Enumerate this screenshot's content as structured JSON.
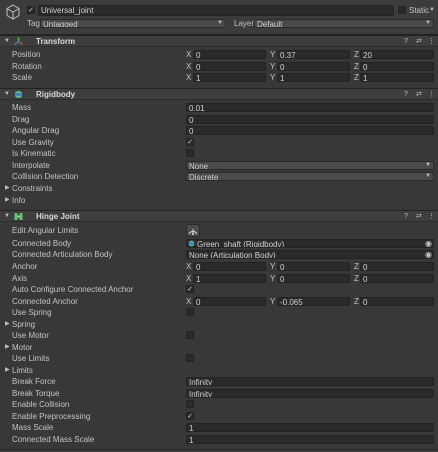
{
  "header": {
    "name": "Universal_joint",
    "static_label": "Static",
    "tag_label": "Tag",
    "tag_value": "Untagged",
    "layer_label": "Layer",
    "layer_value": "Default"
  },
  "transform": {
    "title": "Transform",
    "position_label": "Position",
    "rotation_label": "Rotation",
    "scale_label": "Scale",
    "position": {
      "x": "0",
      "y": "0.37",
      "z": "20"
    },
    "rotation": {
      "x": "0",
      "y": "0",
      "z": "0"
    },
    "scale": {
      "x": "1",
      "y": "1",
      "z": "1"
    }
  },
  "rigidbody": {
    "title": "Rigidbody",
    "mass_label": "Mass",
    "mass": "0.01",
    "drag_label": "Drag",
    "drag": "0",
    "angular_drag_label": "Angular Drag",
    "angular_drag": "0",
    "use_gravity_label": "Use Gravity",
    "use_gravity": true,
    "is_kinematic_label": "Is Kinematic",
    "is_kinematic": false,
    "interpolate_label": "Interpolate",
    "interpolate": "None",
    "collision_detection_label": "Collision Detection",
    "collision_detection": "Discrete",
    "constraints_label": "Constraints",
    "info_label": "Info"
  },
  "hinge": {
    "title": "Hinge Joint",
    "edit_angular_limits_label": "Edit Angular Limits",
    "connected_body_label": "Connected Body",
    "connected_body": "Green_shaft (Rigidbody)",
    "connected_articulation_body_label": "Connected Articulation Body",
    "connected_articulation_body": "None (Articulation Body)",
    "anchor_label": "Anchor",
    "anchor": {
      "x": "0",
      "y": "0",
      "z": "0"
    },
    "axis_label": "Axis",
    "axis": {
      "x": "1",
      "y": "0",
      "z": "0"
    },
    "auto_configure_label": "Auto Configure Connected Anchor",
    "auto_configure": true,
    "connected_anchor_label": "Connected Anchor",
    "connected_anchor": {
      "x": "0",
      "y": "-0.065",
      "z": "0"
    },
    "use_spring_label": "Use Spring",
    "use_spring": false,
    "spring_label": "Spring",
    "use_motor_label": "Use Motor",
    "use_motor": false,
    "motor_label": "Motor",
    "use_limits_label": "Use Limits",
    "use_limits": false,
    "limits_label": "Limits",
    "break_force_label": "Break Force",
    "break_force": "Infinity",
    "break_torque_label": "Break Torque",
    "break_torque": "Infinity",
    "enable_collision_label": "Enable Collision",
    "enable_collision": false,
    "enable_preprocessing_label": "Enable Preprocessing",
    "enable_preprocessing": true,
    "mass_scale_label": "Mass Scale",
    "mass_scale": "1",
    "connected_mass_scale_label": "Connected Mass Scale",
    "connected_mass_scale": "1"
  },
  "axis_letters": {
    "x": "X",
    "y": "Y",
    "z": "Z"
  },
  "check_glyph": "✓",
  "icons": [
    "cube-icon",
    "transform-icon",
    "rigidbody-icon",
    "hinge-joint-icon",
    "help-icon",
    "preset-icon",
    "more-icon",
    "target-icon",
    "edit-angle-icon"
  ]
}
